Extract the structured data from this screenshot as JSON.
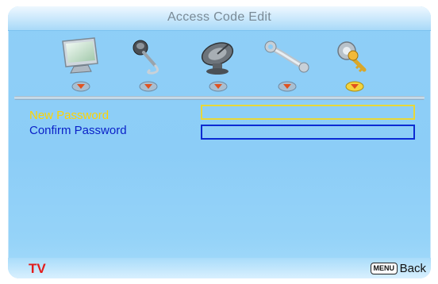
{
  "title": "Access Code Edit",
  "menu_tabs": [
    {
      "icon": "monitor-icon"
    },
    {
      "icon": "microphone-icon"
    },
    {
      "icon": "satellite-dish-icon"
    },
    {
      "icon": "wrench-icon"
    },
    {
      "icon": "key-lock-icon",
      "selected": true
    }
  ],
  "fields": {
    "new_password_label": "New Password",
    "new_password_value": "",
    "confirm_password_label": "Confirm Password",
    "confirm_password_value": ""
  },
  "footer": {
    "source": "TV",
    "menu_key": "MENU",
    "back_label": "Back"
  },
  "colors": {
    "background": "#8ccdf7",
    "focused_label": "#ffd400",
    "label": "#0b22c8",
    "source_label": "#e21b1b"
  }
}
